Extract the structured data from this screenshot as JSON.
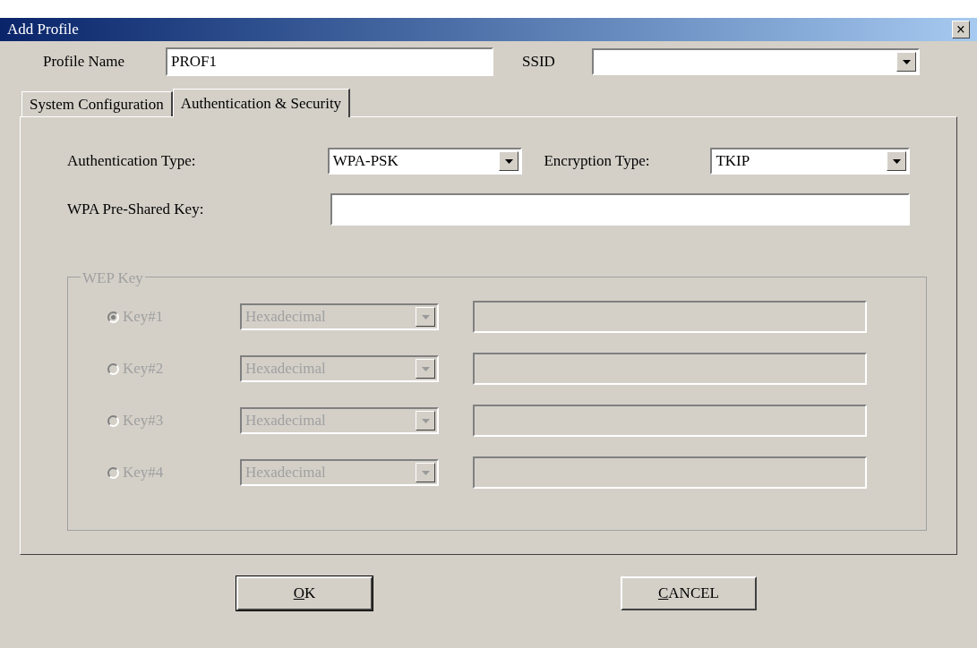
{
  "window": {
    "title": "Add Profile",
    "close": "×"
  },
  "profile_name": {
    "label": "Profile Name",
    "value": "PROF1"
  },
  "ssid": {
    "label": "SSID"
  },
  "tabs": [
    {
      "label": "System Configuration",
      "selected": false
    },
    {
      "label": "Authentication & Security",
      "selected": true
    }
  ],
  "authentication_type": {
    "label": "Authentication Type:",
    "value": "WPA-PSK"
  },
  "encryption_type": {
    "label": "Encryption Type:",
    "value": "TKIP"
  },
  "wpa_key": {
    "label": "WPA Pre-Shared Key:"
  },
  "wep_key": {
    "title": "WEP Key",
    "disabled": true,
    "keys": [
      {
        "label": "Key#1",
        "selected": true,
        "format": "Hexadecimal"
      },
      {
        "label": "Key#2",
        "selected": false,
        "format": "Hexadecimal"
      },
      {
        "label": "Key#3",
        "selected": false,
        "format": "Hexadecimal"
      },
      {
        "label": "Key#4",
        "selected": false,
        "format": "Hexadecimal"
      }
    ]
  },
  "buttons": [
    {
      "label": "OK",
      "default": true
    },
    {
      "label": "CANCEL",
      "default": false
    }
  ]
}
